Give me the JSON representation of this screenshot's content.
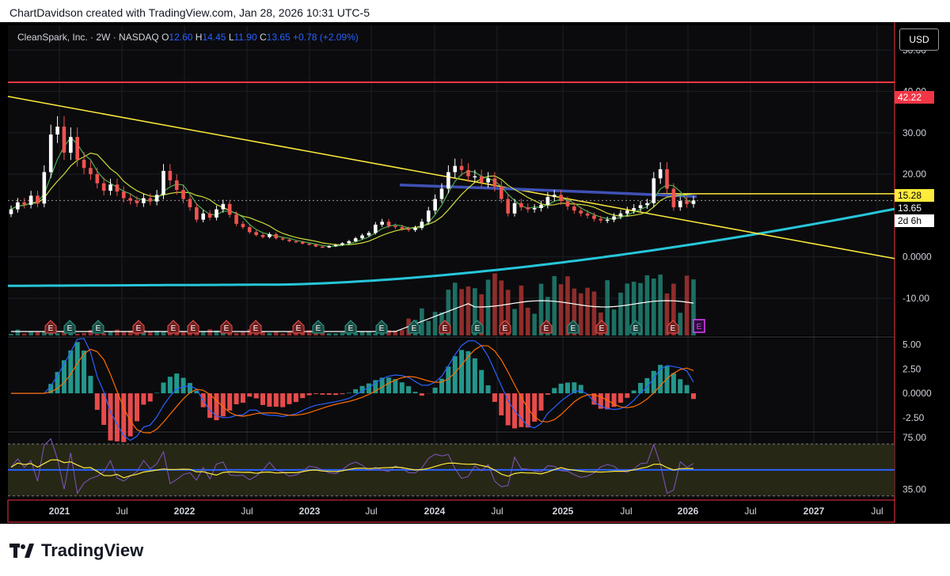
{
  "header": {
    "caption": "ChartDavidson created with TradingView.com, Jan 28, 2026 10:31 UTC-5"
  },
  "legend": {
    "symbol": "CleanSpark, Inc. · 2W · NASDAQ",
    "o_label": "O",
    "o_value": "12.60",
    "h_label": "H",
    "h_value": "14.45",
    "l_label": "L",
    "l_value": "11.90",
    "c_label": "C",
    "c_value": "13.65",
    "change": "+0.78 (+2.09%)"
  },
  "currency_button": "USD",
  "price_tags": {
    "resistance": "42.22",
    "level": "15.28",
    "last": "13.65",
    "countdown": "2d 6h"
  },
  "footer": {
    "logo_text": "TradingView"
  },
  "colors": {
    "up": "#2e9e90",
    "down": "#ef5350",
    "candle_up": "#ffffff",
    "candle_down": "#ef5350",
    "resistance": "#f23645",
    "trendline": "#ffeb3b",
    "support_curve": "#26c6da",
    "blue_line": "#3f51b5"
  },
  "chart_data": [
    {
      "type": "candlestick",
      "title": "",
      "y_axis_labels": [
        "50.00",
        "40.00",
        "30.00",
        "20.00",
        "0.0000",
        "-10.00"
      ],
      "y_ticks": [
        50,
        40,
        30,
        20,
        0,
        -10
      ],
      "x_axis_labels": [
        "2021",
        "Jul",
        "2022",
        "Jul",
        "2023",
        "Jul",
        "2024",
        "Jul",
        "2025",
        "Jul",
        "2026",
        "Jul",
        "2027",
        "Jul"
      ],
      "ylim": [
        -19,
        56
      ],
      "horizontal_lines": [
        {
          "value": 42.22,
          "label": "42.22"
        },
        {
          "value": 15.28,
          "label": "15.28"
        }
      ],
      "last_price": 13.65,
      "closes": [
        11.5,
        13.2,
        12.6,
        14.8,
        12.9,
        20.5,
        29.6,
        31.5,
        25.2,
        29.0,
        23.5,
        21.5,
        20.0,
        17.8,
        16.0,
        17.5,
        15.8,
        14.2,
        13.6,
        13.0,
        14.2,
        13.4,
        15.0,
        20.8,
        18.5,
        16.2,
        14.0,
        12.0,
        9.0,
        10.5,
        9.5,
        11.5,
        12.8,
        10.2,
        8.0,
        7.2,
        6.0,
        5.3,
        4.8,
        5.5,
        4.5,
        4.2,
        3.8,
        3.6,
        3.2,
        3.0,
        2.5,
        2.3,
        2.6,
        2.9,
        3.3,
        3.8,
        4.5,
        5.2,
        5.8,
        7.8,
        8.5,
        7.5,
        7.2,
        6.8,
        6.5,
        7.0,
        8.5,
        11.2,
        14.0,
        16.5,
        20.5,
        22.0,
        21.0,
        19.5,
        19.5,
        18.0,
        19.0,
        17.0,
        14.0,
        10.5,
        13.0,
        12.0,
        11.5,
        11.8,
        12.6,
        14.5,
        15.0,
        13.5,
        12.2,
        11.2,
        10.5,
        10.0,
        9.2,
        8.8,
        9.0,
        9.8,
        10.5,
        11.2,
        11.8,
        12.5,
        13.0,
        19.0,
        21.2,
        16.5,
        12.0,
        13.5,
        12.8,
        13.65
      ],
      "volume_labels": [
        "E",
        "E",
        "E",
        "E",
        "E",
        "E",
        "E",
        "E",
        "E",
        "E",
        "E",
        "E",
        "E",
        "E",
        "E",
        "E",
        "E",
        "E",
        "E",
        "E",
        "E",
        "E",
        "E",
        "E",
        "E"
      ]
    },
    {
      "type": "histogram",
      "title": "",
      "y_axis_labels": [
        "5.00",
        "2.50",
        "0.0000",
        "-2.50"
      ],
      "y_ticks": [
        5.0,
        2.5,
        0,
        -2.5
      ],
      "ylim": [
        -3.8,
        5.6
      ]
    },
    {
      "type": "line",
      "title": "",
      "y_axis_labels": [
        "75.00",
        "35.00"
      ],
      "y_ticks": [
        75,
        35
      ],
      "ylim": [
        28,
        78
      ],
      "bands": [
        30,
        50,
        70
      ]
    }
  ]
}
